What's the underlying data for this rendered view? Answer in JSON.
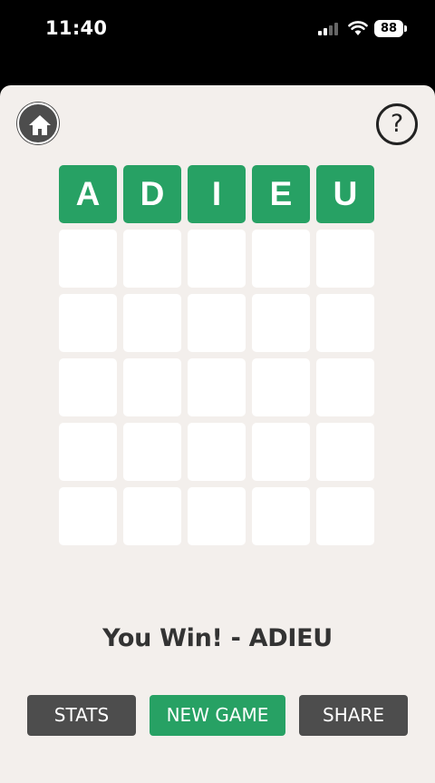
{
  "status_bar": {
    "time": "11:40",
    "battery": "88"
  },
  "colors": {
    "correct": "#27a164",
    "empty": "#ffffff",
    "button_dark": "#4d4d4d",
    "background": "#f3efec"
  },
  "icons": {
    "home": "home-icon",
    "help": "help-icon",
    "help_glyph": "?"
  },
  "board": {
    "rows": [
      {
        "tiles": [
          {
            "letter": "A",
            "state": "correct"
          },
          {
            "letter": "D",
            "state": "correct"
          },
          {
            "letter": "I",
            "state": "correct"
          },
          {
            "letter": "E",
            "state": "correct"
          },
          {
            "letter": "U",
            "state": "correct"
          }
        ]
      },
      {
        "tiles": [
          {
            "letter": "",
            "state": "empty"
          },
          {
            "letter": "",
            "state": "empty"
          },
          {
            "letter": "",
            "state": "empty"
          },
          {
            "letter": "",
            "state": "empty"
          },
          {
            "letter": "",
            "state": "empty"
          }
        ]
      },
      {
        "tiles": [
          {
            "letter": "",
            "state": "empty"
          },
          {
            "letter": "",
            "state": "empty"
          },
          {
            "letter": "",
            "state": "empty"
          },
          {
            "letter": "",
            "state": "empty"
          },
          {
            "letter": "",
            "state": "empty"
          }
        ]
      },
      {
        "tiles": [
          {
            "letter": "",
            "state": "empty"
          },
          {
            "letter": "",
            "state": "empty"
          },
          {
            "letter": "",
            "state": "empty"
          },
          {
            "letter": "",
            "state": "empty"
          },
          {
            "letter": "",
            "state": "empty"
          }
        ]
      },
      {
        "tiles": [
          {
            "letter": "",
            "state": "empty"
          },
          {
            "letter": "",
            "state": "empty"
          },
          {
            "letter": "",
            "state": "empty"
          },
          {
            "letter": "",
            "state": "empty"
          },
          {
            "letter": "",
            "state": "empty"
          }
        ]
      },
      {
        "tiles": [
          {
            "letter": "",
            "state": "empty"
          },
          {
            "letter": "",
            "state": "empty"
          },
          {
            "letter": "",
            "state": "empty"
          },
          {
            "letter": "",
            "state": "empty"
          },
          {
            "letter": "",
            "state": "empty"
          }
        ]
      }
    ]
  },
  "result_text": "You Win! - ADIEU",
  "buttons": {
    "stats": "STATS",
    "new_game": "NEW GAME",
    "share": "SHARE"
  }
}
